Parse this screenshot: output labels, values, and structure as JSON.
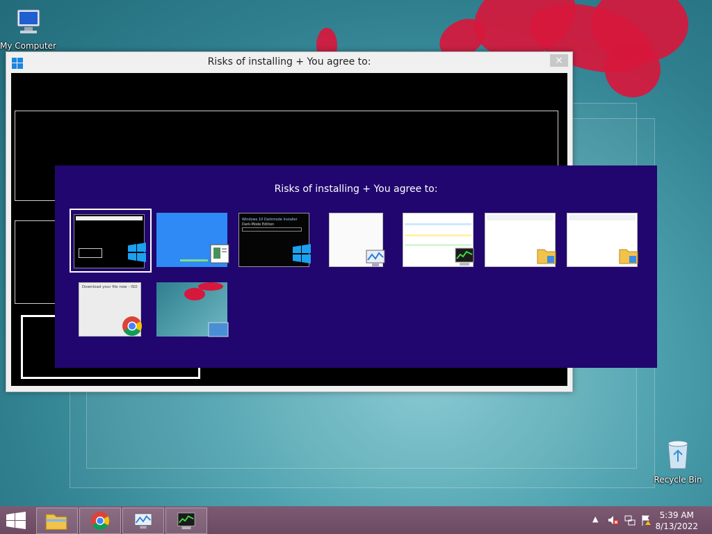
{
  "desktop": {
    "icons": [
      {
        "label": "My Computer",
        "icon": "computer-icon"
      },
      {
        "label": "Recycle Bin",
        "icon": "recycle-bin-icon"
      }
    ]
  },
  "window": {
    "title": "Risks of installing + You agree to:",
    "close_label": "×"
  },
  "switcher": {
    "title": "Risks of installing + You agree to:",
    "thumbnails": [
      {
        "app": "Installer window",
        "badge": "windows-logo-icon",
        "selected": true
      },
      {
        "app": "Blue screen installer",
        "badge": "document-icon",
        "selected": false
      },
      {
        "app": "Windows 10 Dark-Mode installer",
        "badge": "windows-logo-icon",
        "selected": false,
        "caption1": "Windows 10 Darkmode Installer",
        "caption2": "Dark-Mode Edition"
      },
      {
        "app": "Resource monitor",
        "badge": "resource-monitor-icon",
        "selected": false
      },
      {
        "app": "Task manager",
        "badge": "task-manager-icon",
        "selected": false
      },
      {
        "app": "File Explorer",
        "badge": "folder-icon",
        "selected": false
      },
      {
        "app": "File Explorer",
        "badge": "folder-icon",
        "selected": false
      },
      {
        "app": "Chrome",
        "badge": "chrome-icon",
        "selected": false,
        "caption1": "Download your file now - ISO"
      },
      {
        "app": "Desktop",
        "badge": "desktop-icon",
        "selected": false
      }
    ]
  },
  "taskbar": {
    "buttons": [
      {
        "name": "file-explorer-taskbar-button",
        "icon": "folder-icon"
      },
      {
        "name": "chrome-taskbar-button",
        "icon": "chrome-icon"
      },
      {
        "name": "resource-monitor-taskbar-button",
        "icon": "resource-monitor-icon"
      },
      {
        "name": "task-manager-taskbar-button",
        "icon": "task-manager-icon"
      }
    ],
    "clock_time": "5:39 AM",
    "clock_date": "8/13/2022"
  }
}
